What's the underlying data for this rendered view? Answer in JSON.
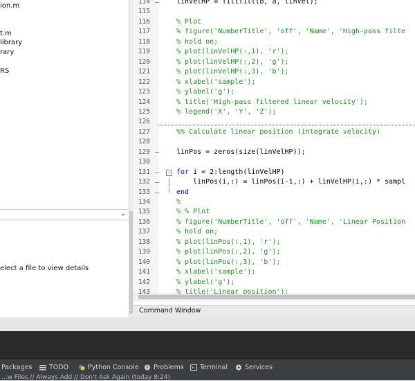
{
  "file_browser": {
    "items": [
      "ion.m",
      "t.m",
      "library",
      "rary",
      "RS"
    ],
    "details_hint": "elect a file to view details"
  },
  "editor": {
    "lines": [
      {
        "num": "114",
        "html": "linVelHP = filtfilt(b, a, linVel);",
        "comment": false
      },
      {
        "num": "115",
        "html": "",
        "comment": false
      },
      {
        "num": "116",
        "html": "% Plot",
        "comment": true
      },
      {
        "num": "117",
        "html": "% figure('NumberTitle', 'off', 'Name', 'High-pass filte",
        "comment": true
      },
      {
        "num": "118",
        "html": "% hold on;",
        "comment": true
      },
      {
        "num": "119",
        "html": "% plot(linVelHP(:,1), 'r');",
        "comment": true
      },
      {
        "num": "120",
        "html": "% plot(linVelHP(:,2), 'g');",
        "comment": true
      },
      {
        "num": "121",
        "html": "% plot(linVelHP(:,3), 'b');",
        "comment": true
      },
      {
        "num": "122",
        "html": "% xlabel('sample');",
        "comment": true
      },
      {
        "num": "123",
        "html": "% ylabel('g');",
        "comment": true
      },
      {
        "num": "124",
        "html": "% title('High-pass filtered linear velocity');",
        "comment": true
      },
      {
        "num": "125",
        "html": "% legend('X', 'Y', 'Z');",
        "comment": true
      },
      {
        "num": "126",
        "html": "",
        "comment": false
      },
      {
        "num": "127",
        "html": "%% Calculate linear position (integrate velocity)",
        "comment": true
      },
      {
        "num": "128",
        "html": "",
        "comment": false
      },
      {
        "num": "129",
        "html": "linPos = zeros(size(linVelHP));",
        "comment": false
      },
      {
        "num": "130",
        "html": "",
        "comment": false
      },
      {
        "num": "131",
        "html": "for i = 2:length(linVelHP)",
        "comment": false
      },
      {
        "num": "132",
        "html": "    linPos(i,:) = linPos(i-1,:) + linVelHP(i,:) * sampl",
        "comment": false
      },
      {
        "num": "133",
        "html": "end",
        "comment": false
      },
      {
        "num": "134",
        "html": "%",
        "comment": true
      },
      {
        "num": "135",
        "html": "% % Plot",
        "comment": true
      },
      {
        "num": "136",
        "html": "% figure('NumberTitle', 'off', 'Name', 'Linear Position",
        "comment": true
      },
      {
        "num": "137",
        "html": "% hold on;",
        "comment": true
      },
      {
        "num": "138",
        "html": "% plot(linPos(:,1), 'r');",
        "comment": true
      },
      {
        "num": "139",
        "html": "% plot(linPos(:,2), 'g');",
        "comment": true
      },
      {
        "num": "140",
        "html": "% plot(linPos(:,3), 'b');",
        "comment": true
      },
      {
        "num": "141",
        "html": "% xlabel('sample');",
        "comment": true
      },
      {
        "num": "142",
        "html": "% ylabel('g');",
        "comment": true
      },
      {
        "num": "143",
        "html": "% title('Linear position');",
        "comment": true
      }
    ]
  },
  "command_window": {
    "title": "Command Window"
  },
  "tool_windows": [
    {
      "label": "Packages",
      "icon": "packages-icon"
    },
    {
      "label": "TODO",
      "icon": "todo-icon"
    },
    {
      "label": "Python Console",
      "icon": "python-console-icon"
    },
    {
      "label": "Problems",
      "icon": "problems-icon"
    },
    {
      "label": "Terminal",
      "icon": "terminal-icon"
    },
    {
      "label": "Services",
      "icon": "services-icon"
    }
  ],
  "status": {
    "text": "...w Files // Always Add // Don't Ask Again (today 8:24)"
  },
  "colors": {
    "comment": "#228b22",
    "keyword": "#0000ff",
    "toolbar_bg": "#3c3f41"
  }
}
